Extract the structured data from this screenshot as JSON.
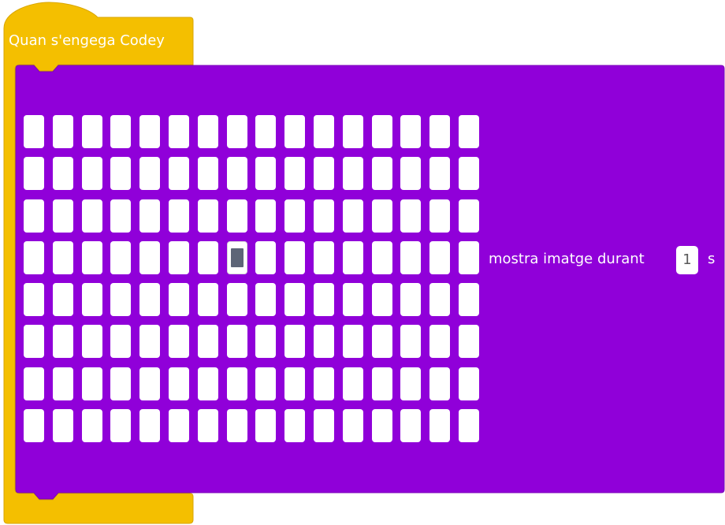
{
  "hat_block": {
    "label": "Quan s'engega Codey",
    "color": "#f4bf00"
  },
  "show_image_block": {
    "color": "#9000d9",
    "label": "mostra imatge durant",
    "duration": "1",
    "unit": "s",
    "led_matrix": {
      "rows": 8,
      "cols": 16,
      "lit": [
        [
          3,
          7
        ]
      ]
    }
  }
}
